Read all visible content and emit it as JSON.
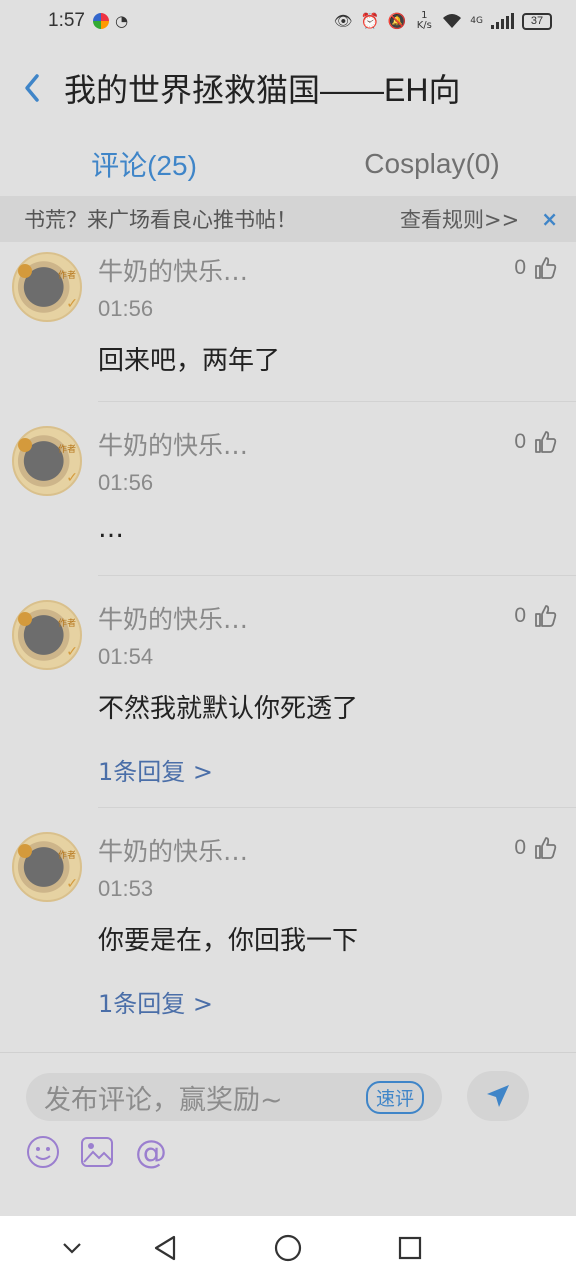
{
  "status": {
    "time": "1:57",
    "speed_value": "1",
    "speed_unit": "K/s",
    "network": "4G",
    "battery": "37"
  },
  "header": {
    "title": "我的世界拯救猫国——EH向"
  },
  "tabs": [
    {
      "label": "评论(25)",
      "active": true
    },
    {
      "label": "Cosplay(0)",
      "active": false
    }
  ],
  "notice": {
    "text": "书荒？来广场看良心推书帖！",
    "rule_link": "查看规则>>",
    "close": "×"
  },
  "comments": [
    {
      "user": "牛奶的快乐…",
      "time": "01:56",
      "likes": "0",
      "text": "回来吧，两年了",
      "replies": ""
    },
    {
      "user": "牛奶的快乐…",
      "time": "01:56",
      "likes": "0",
      "text": "…",
      "replies": ""
    },
    {
      "user": "牛奶的快乐…",
      "time": "01:54",
      "likes": "0",
      "text": "不然我就默认你死透了",
      "replies": "1条回复 >"
    },
    {
      "user": "牛奶的快乐…",
      "time": "01:53",
      "likes": "0",
      "text": "你要是在，你回我一下",
      "replies": "1条回复 >"
    }
  ],
  "avatar_tag": "作者",
  "composer": {
    "placeholder": "发布评论，赢奖励~",
    "quick_label": "速评"
  },
  "colors": {
    "accent": "#3f85c8",
    "overlay_bg": "#e0e0e0"
  }
}
